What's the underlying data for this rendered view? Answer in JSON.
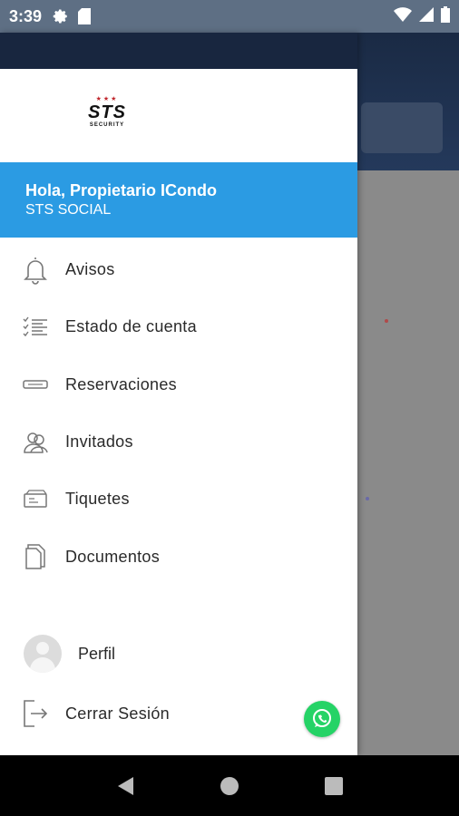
{
  "status_bar": {
    "time": "3:39",
    "icons": [
      "gear-icon",
      "sd-card-icon",
      "wifi-icon",
      "signal-icon",
      "battery-icon"
    ]
  },
  "drawer": {
    "logo": {
      "brand": "STS",
      "sub": "SECURITY"
    },
    "user": {
      "greeting": "Hola, Propietario ICondo",
      "organization": "STS SOCIAL"
    },
    "menu_items": [
      {
        "label": "Avisos",
        "icon": "bell-icon"
      },
      {
        "label": "Estado de cuenta",
        "icon": "checklist-icon"
      },
      {
        "label": "Reservaciones",
        "icon": "ticket-icon"
      },
      {
        "label": "Invitados",
        "icon": "guests-icon"
      },
      {
        "label": "Tiquetes",
        "icon": "tickets-icon"
      },
      {
        "label": "Documentos",
        "icon": "documents-icon"
      }
    ],
    "profile": {
      "label": "Perfil",
      "icon": "avatar-icon"
    },
    "logout": {
      "label": "Cerrar Sesión",
      "icon": "logout-icon"
    }
  },
  "fab": {
    "icon": "whatsapp-icon"
  },
  "nav_bar": {
    "icons": [
      "back-icon",
      "home-icon",
      "recents-icon"
    ]
  },
  "colors": {
    "banner": "#2b9be3",
    "header_dark": "#18263f",
    "whatsapp": "#25d366",
    "scrim": "#7b7b7b"
  }
}
